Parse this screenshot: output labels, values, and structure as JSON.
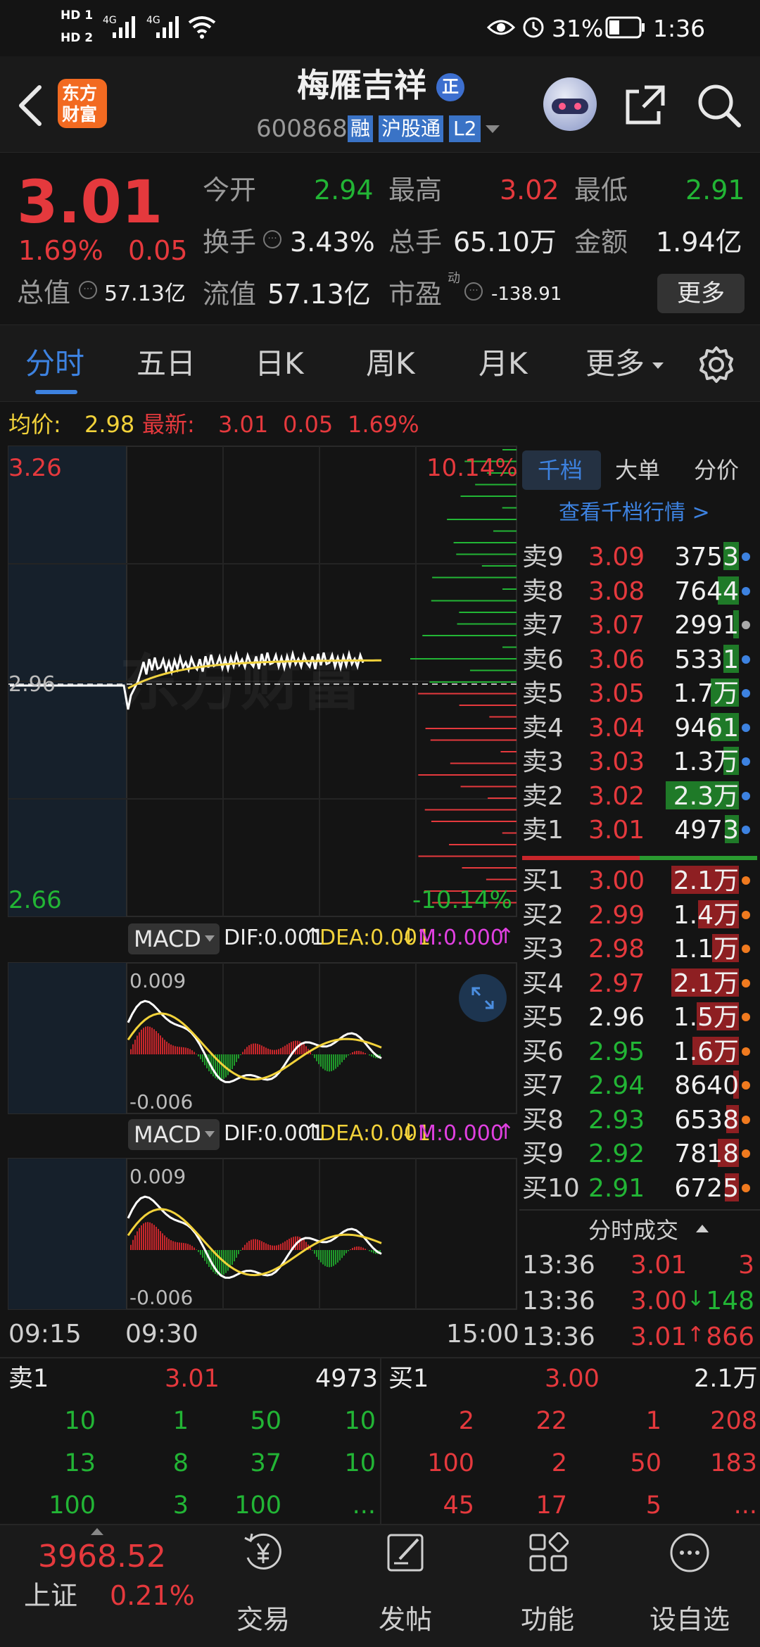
{
  "status": {
    "hd1": "HD 1",
    "hd2": "HD 2",
    "net1": "4G",
    "net2": "4G",
    "battery": "31%",
    "time": "1:36"
  },
  "header": {
    "logo_top": "东方",
    "logo_bottom": "财富",
    "stock_name": "梅雁吉祥",
    "name_badge": "正",
    "stock_code": "600868",
    "tags": [
      "融",
      "沪股通",
      "L2"
    ]
  },
  "quote": {
    "price": "3.01",
    "change_pct": "1.69%",
    "change": "0.05",
    "open_label": "今开",
    "open": "2.94",
    "high_label": "最高",
    "high": "3.02",
    "low_label": "最低",
    "low": "2.91",
    "turnover_label": "换手",
    "turnover": "3.43%",
    "volume_label": "总手",
    "volume": "65.10万",
    "amount_label": "金额",
    "amount": "1.94亿",
    "mktcap_label": "总值",
    "mktcap": "57.13亿",
    "float_label": "流值",
    "float": "57.13亿",
    "pe_label": "市盈",
    "pe_sup": "动",
    "pe": "-138.91",
    "more_button": "更多"
  },
  "tabs": [
    "分时",
    "五日",
    "日K",
    "周K",
    "月K",
    "更多"
  ],
  "avg": {
    "avg_label": "均价:",
    "avg_value": "2.98",
    "latest_label": "最新:",
    "latest_value": "3.01",
    "change": "0.05",
    "change_pct": "1.69%"
  },
  "chart": {
    "price_high": "3.26",
    "price_low": "2.66",
    "pct_high": "10.14%",
    "pct_low": "-10.14%",
    "ref_price": "2.96",
    "time_start": "09:15",
    "time_open": "09:30",
    "time_end": "15:00",
    "watermark": "东方财富",
    "macd": [
      {
        "label": "MACD",
        "dif": "DIF:0.001",
        "dea": "DEA:0.001",
        "m": "M:0.000",
        "top": "0.009",
        "bottom": "-0.006"
      },
      {
        "label": "MACD",
        "dif": "DIF:0.001",
        "dea": "DEA:0.001",
        "m": "M:0.000",
        "top": "0.009",
        "bottom": "-0.006"
      }
    ]
  },
  "orderbook": {
    "tabs": [
      "千档",
      "大单",
      "分价"
    ],
    "link": "查看千档行情 >",
    "asks": [
      {
        "label": "卖9",
        "price": "3.09",
        "vol": "3753",
        "color": "#e5393d"
      },
      {
        "label": "卖8",
        "price": "3.08",
        "vol": "7644",
        "color": "#e5393d"
      },
      {
        "label": "卖7",
        "price": "3.07",
        "vol": "2991",
        "color": "#e5393d"
      },
      {
        "label": "卖6",
        "price": "3.06",
        "vol": "5331",
        "color": "#e5393d"
      },
      {
        "label": "卖5",
        "price": "3.05",
        "vol": "1.7万",
        "color": "#e5393d"
      },
      {
        "label": "卖4",
        "price": "3.04",
        "vol": "9461",
        "color": "#e5393d"
      },
      {
        "label": "卖3",
        "price": "3.03",
        "vol": "1.3万",
        "color": "#e5393d"
      },
      {
        "label": "卖2",
        "price": "3.02",
        "vol": "2.3万",
        "color": "#e5393d"
      },
      {
        "label": "卖1",
        "price": "3.01",
        "vol": "4973",
        "color": "#e5393d"
      }
    ],
    "bids": [
      {
        "label": "买1",
        "price": "3.00",
        "vol": "2.1万",
        "color": "#e5393d"
      },
      {
        "label": "买2",
        "price": "2.99",
        "vol": "1.4万",
        "color": "#e5393d"
      },
      {
        "label": "买3",
        "price": "2.98",
        "vol": "1.1万",
        "color": "#e5393d"
      },
      {
        "label": "买4",
        "price": "2.97",
        "vol": "2.1万",
        "color": "#e5393d"
      },
      {
        "label": "买5",
        "price": "2.96",
        "vol": "1.5万",
        "color": "#ececec"
      },
      {
        "label": "买6",
        "price": "2.95",
        "vol": "1.6万",
        "color": "#22b535"
      },
      {
        "label": "买7",
        "price": "2.94",
        "vol": "8640",
        "color": "#22b535"
      },
      {
        "label": "买8",
        "price": "2.93",
        "vol": "6538",
        "color": "#22b535"
      },
      {
        "label": "买9",
        "price": "2.92",
        "vol": "7818",
        "color": "#22b535"
      },
      {
        "label": "买10",
        "price": "2.91",
        "vol": "6725",
        "color": "#22b535"
      }
    ],
    "trades_title": "分时成交",
    "trades": [
      {
        "time": "13:36",
        "price": "3.01",
        "arrow": "",
        "vol": "3",
        "vol_color": "#e5393d"
      },
      {
        "time": "13:36",
        "price": "3.00",
        "arrow": "↓",
        "vol": "148",
        "vol_color": "#22b535"
      },
      {
        "time": "13:36",
        "price": "3.01",
        "arrow": "↑",
        "vol": "866",
        "vol_color": "#e5393d"
      }
    ]
  },
  "bottom_queue": {
    "sell": {
      "label": "卖1",
      "price": "3.01",
      "vol": "4973",
      "rows": [
        [
          "10",
          "1",
          "50",
          "10"
        ],
        [
          "13",
          "8",
          "37",
          "10"
        ],
        [
          "100",
          "3",
          "100",
          "..."
        ]
      ]
    },
    "buy": {
      "label": "买1",
      "price": "3.00",
      "vol": "2.1万",
      "rows": [
        [
          "2",
          "22",
          "1",
          "208"
        ],
        [
          "100",
          "2",
          "50",
          "183"
        ],
        [
          "45",
          "17",
          "5",
          "..."
        ]
      ]
    }
  },
  "nav": {
    "index_value": "3968.52",
    "index_name": "上证",
    "index_change": "0.21%",
    "items": [
      "交易",
      "发帖",
      "功能",
      "设自选"
    ]
  }
}
